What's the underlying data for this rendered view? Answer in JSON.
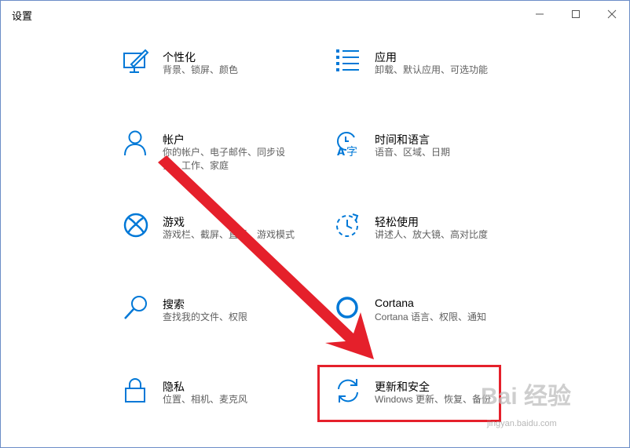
{
  "window": {
    "title": "设置",
    "controls": {
      "minimize": "minimize-icon",
      "maximize": "maximize-icon",
      "close": "close-icon"
    }
  },
  "accent_color": "#0078d7",
  "tiles": [
    {
      "name": "个性化",
      "desc": [
        "背景、锁屏、颜色"
      ],
      "icon": "personalization-icon"
    },
    {
      "name": "应用",
      "desc": [
        "卸载、默认应用、可选功能"
      ],
      "icon": "apps-icon"
    },
    {
      "name": "帐户",
      "desc": [
        "你的帐户、电子邮件、同步设",
        "置、工作、家庭"
      ],
      "icon": "account-icon"
    },
    {
      "name": "时间和语言",
      "desc": [
        "语音、区域、日期"
      ],
      "icon": "time-language-icon"
    },
    {
      "name": "游戏",
      "desc": [
        "游戏栏、截屏、直播、游戏模式"
      ],
      "icon": "xbox-icon"
    },
    {
      "name": "轻松使用",
      "desc": [
        "讲述人、放大镜、高对比度"
      ],
      "icon": "ease-of-access-icon"
    },
    {
      "name": "搜索",
      "desc": [
        "查找我的文件、权限"
      ],
      "icon": "search-icon"
    },
    {
      "name": "Cortana",
      "desc": [
        "Cortana 语言、权限、通知"
      ],
      "icon": "cortana-icon"
    },
    {
      "name": "隐私",
      "desc": [
        "位置、相机、麦克风"
      ],
      "icon": "lock-icon"
    },
    {
      "name": "更新和安全",
      "desc": [
        "Windows 更新、恢复、备份"
      ],
      "icon": "update-sync-icon"
    }
  ],
  "annotation": {
    "highlight_color": "#e5202b",
    "arrow_color": "#e5202b"
  },
  "watermark": {
    "main": "Bai 经验",
    "sub": "jingyan.baidu.com"
  }
}
